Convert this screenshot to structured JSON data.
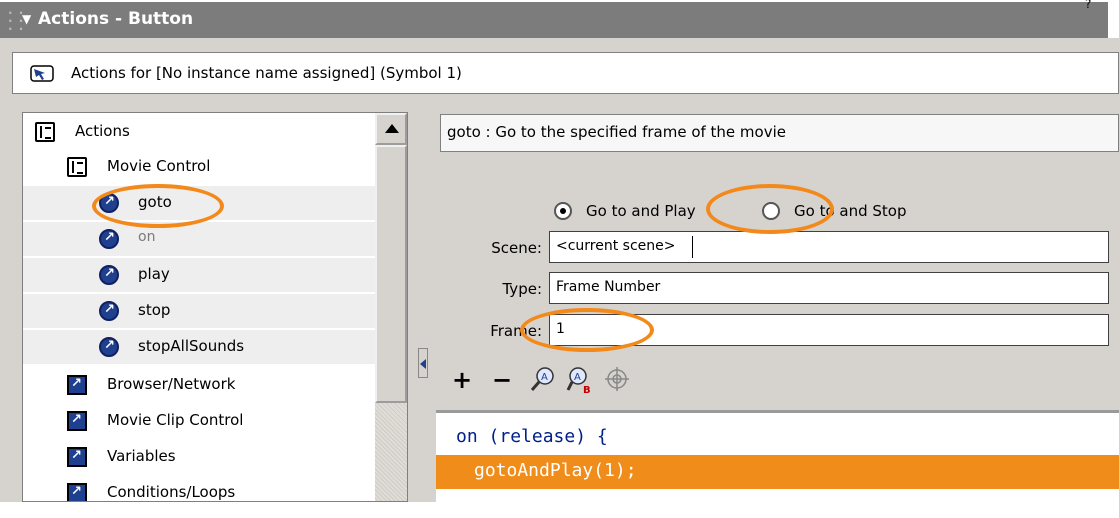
{
  "panel": {
    "title": "Actions - Button",
    "collapse_arrow": "▼",
    "marker": "?"
  },
  "target": {
    "icon": "arrow-pointer-icon",
    "text": "Actions for [No instance name assigned] (Symbol 1)"
  },
  "tree": {
    "root": {
      "label": "Actions",
      "icon": "book-icon"
    },
    "category": {
      "label": "Movie Control",
      "icon": "book-icon"
    },
    "items": [
      {
        "label": "goto",
        "icon": "action-circle-icon",
        "dim": false
      },
      {
        "label": "on",
        "icon": "action-circle-icon",
        "dim": true
      },
      {
        "label": "play",
        "icon": "action-circle-icon",
        "dim": false
      },
      {
        "label": "stop",
        "icon": "action-circle-icon",
        "dim": false
      },
      {
        "label": "stopAllSounds",
        "icon": "action-circle-icon",
        "dim": false
      }
    ],
    "groups": [
      {
        "label": "Browser/Network",
        "icon": "action-square-icon"
      },
      {
        "label": "Movie Clip Control",
        "icon": "action-square-icon"
      },
      {
        "label": "Variables",
        "icon": "action-square-icon"
      },
      {
        "label": "Conditions/Loops",
        "icon": "action-square-icon"
      }
    ]
  },
  "description": "goto : Go to the specified frame of the movie",
  "options": {
    "mode": [
      {
        "label": "Go to and Play",
        "checked": true
      },
      {
        "label": "Go to and Stop",
        "checked": false
      }
    ],
    "scene": {
      "label": "Scene:",
      "value": "<current scene>"
    },
    "type": {
      "label": "Type:",
      "value": "Frame Number"
    },
    "frame": {
      "label": "Frame:",
      "value": "1"
    }
  },
  "toolbar": {
    "add": "+",
    "remove": "−",
    "find_icon": "find-icon",
    "replace_icon": "replace-icon",
    "target_icon": "crosshair-icon"
  },
  "code": {
    "line1_keyword": "on",
    "line1_rest": " (release) {",
    "line2": "gotoAndPlay(1);"
  },
  "colors": {
    "header": "#7c7c7c",
    "highlight": "#f08c1a",
    "annotation": "#f2891a",
    "icon_blue": "#1f3f8f"
  }
}
